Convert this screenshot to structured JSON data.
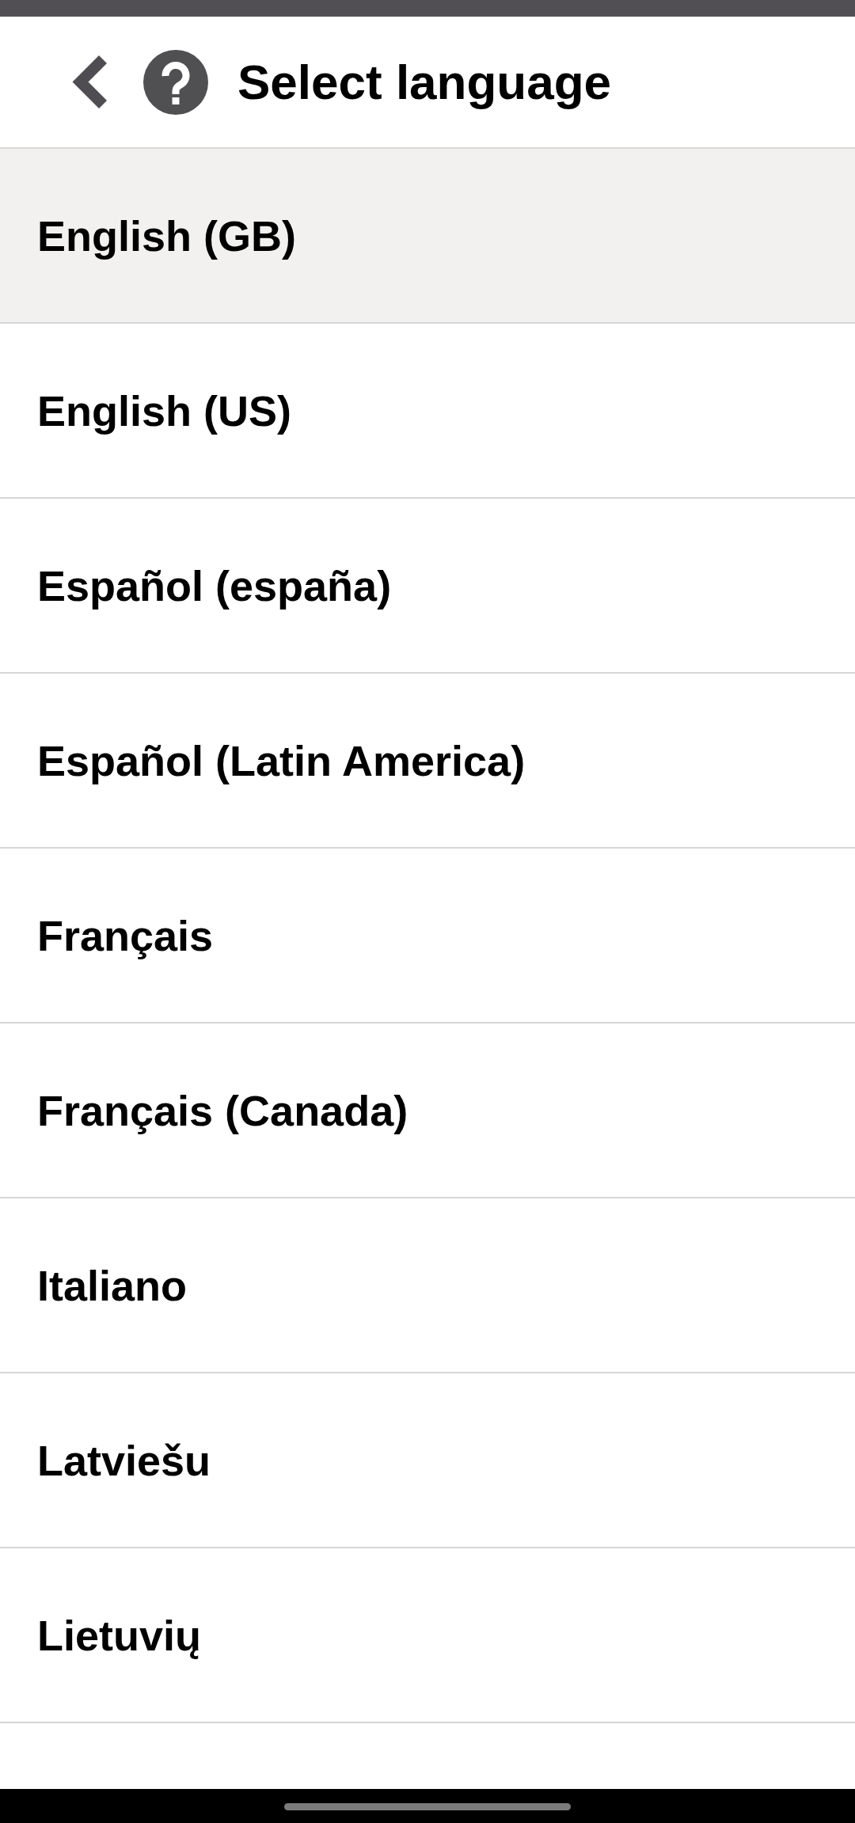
{
  "header": {
    "title": "Select language"
  },
  "languages": [
    {
      "label": "English (GB)",
      "selected": true
    },
    {
      "label": "English (US)",
      "selected": false
    },
    {
      "label": "Español (españa)",
      "selected": false
    },
    {
      "label": "Español (Latin America)",
      "selected": false
    },
    {
      "label": "Français",
      "selected": false
    },
    {
      "label": "Français (Canada)",
      "selected": false
    },
    {
      "label": "Italiano",
      "selected": false
    },
    {
      "label": "Latviešu",
      "selected": false
    },
    {
      "label": "Lietuvių",
      "selected": false
    }
  ]
}
